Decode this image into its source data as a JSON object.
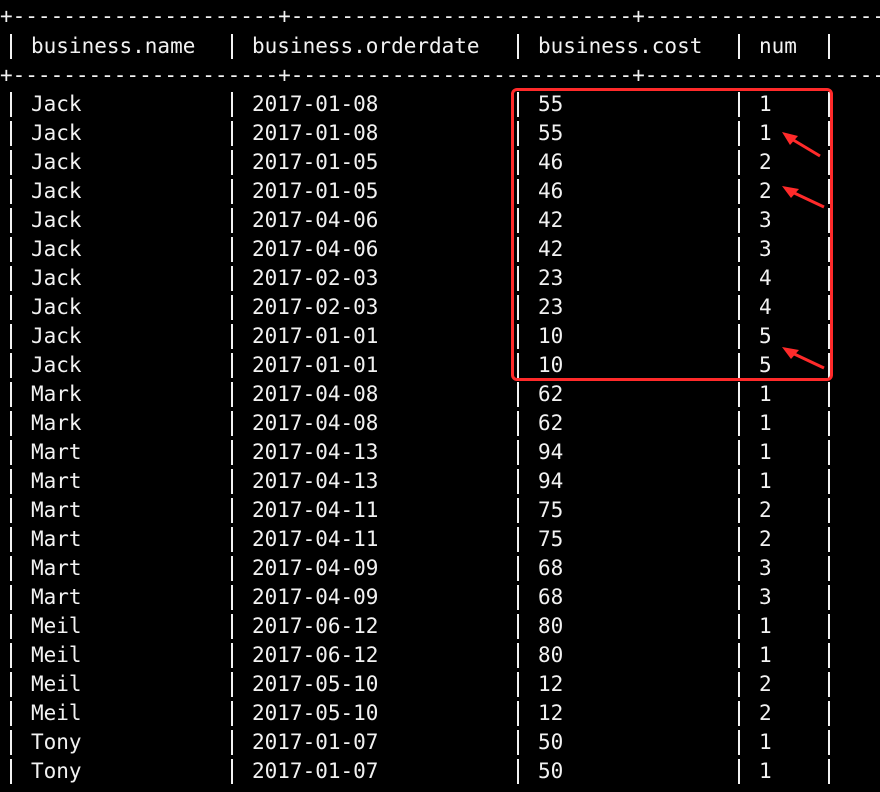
{
  "table": {
    "border_line": "+---------------------+---------------------------+---------------------+-------+--+",
    "headers": [
      "business.name",
      "business.orderdate",
      "business.cost",
      "num"
    ],
    "rows": [
      [
        "Jack",
        "2017-01-08",
        "55",
        "1"
      ],
      [
        "Jack",
        "2017-01-08",
        "55",
        "1"
      ],
      [
        "Jack",
        "2017-01-05",
        "46",
        "2"
      ],
      [
        "Jack",
        "2017-01-05",
        "46",
        "2"
      ],
      [
        "Jack",
        "2017-04-06",
        "42",
        "3"
      ],
      [
        "Jack",
        "2017-04-06",
        "42",
        "3"
      ],
      [
        "Jack",
        "2017-02-03",
        "23",
        "4"
      ],
      [
        "Jack",
        "2017-02-03",
        "23",
        "4"
      ],
      [
        "Jack",
        "2017-01-01",
        "10",
        "5"
      ],
      [
        "Jack",
        "2017-01-01",
        "10",
        "5"
      ],
      [
        "Mark",
        "2017-04-08",
        "62",
        "1"
      ],
      [
        "Mark",
        "2017-04-08",
        "62",
        "1"
      ],
      [
        "Mart",
        "2017-04-13",
        "94",
        "1"
      ],
      [
        "Mart",
        "2017-04-13",
        "94",
        "1"
      ],
      [
        "Mart",
        "2017-04-11",
        "75",
        "2"
      ],
      [
        "Mart",
        "2017-04-11",
        "75",
        "2"
      ],
      [
        "Mart",
        "2017-04-09",
        "68",
        "3"
      ],
      [
        "Mart",
        "2017-04-09",
        "68",
        "3"
      ],
      [
        "Meil",
        "2017-06-12",
        "80",
        "1"
      ],
      [
        "Meil",
        "2017-06-12",
        "80",
        "1"
      ],
      [
        "Meil",
        "2017-05-10",
        "12",
        "2"
      ],
      [
        "Meil",
        "2017-05-10",
        "12",
        "2"
      ],
      [
        "Tony",
        "2017-01-07",
        "50",
        "1"
      ],
      [
        "Tony",
        "2017-01-07",
        "50",
        "1"
      ]
    ]
  },
  "colors": {
    "background": "#000000",
    "text": "#f2f2f2",
    "annotation": "#ff2a2a"
  },
  "annotations": {
    "highlight_box": "red-rectangle",
    "arrows": [
      "red-arrow",
      "red-arrow",
      "red-arrow"
    ]
  }
}
